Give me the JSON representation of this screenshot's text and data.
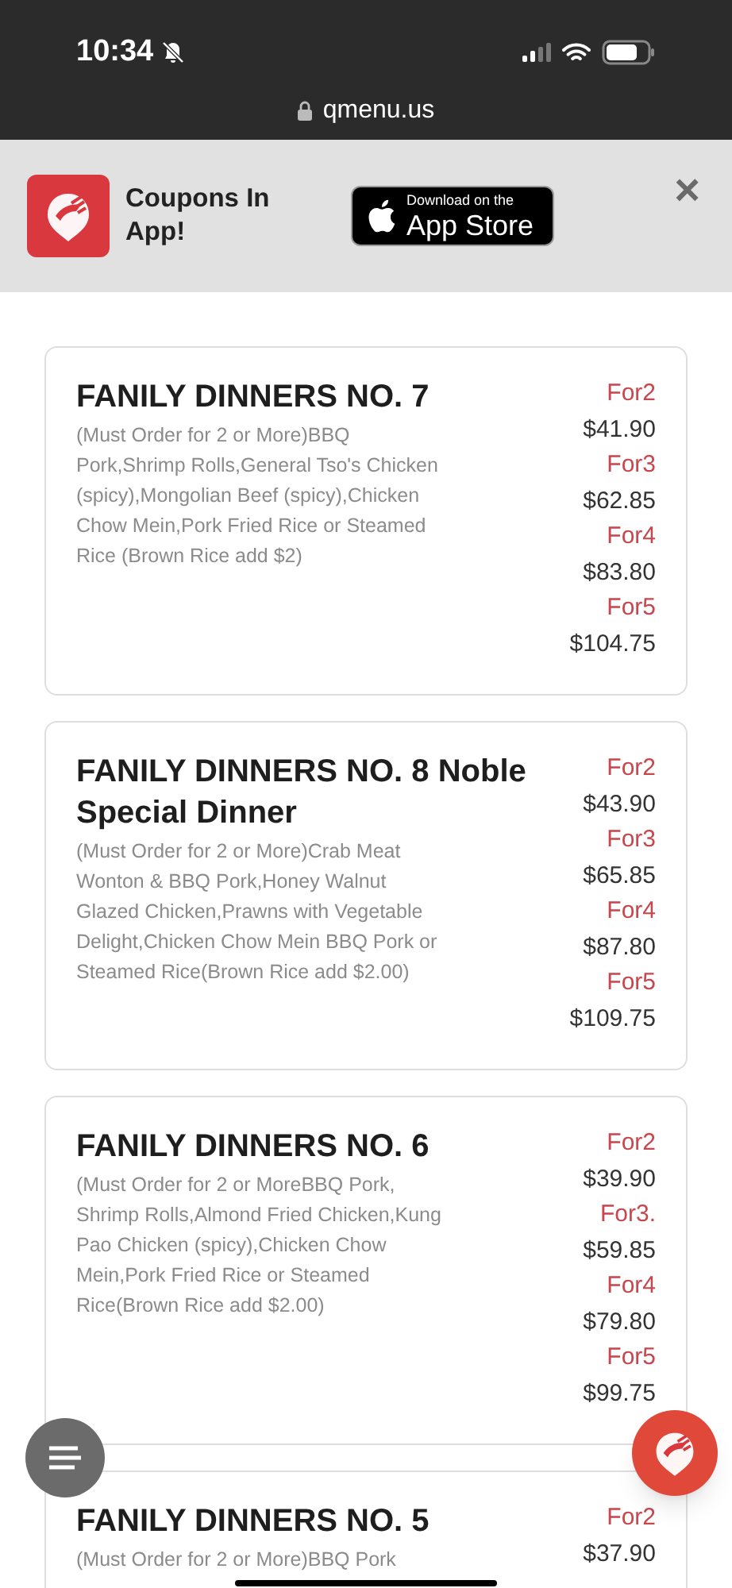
{
  "status_bar": {
    "time": "10:34"
  },
  "browser": {
    "url": "qmenu.us"
  },
  "banner": {
    "text": "Coupons In App!",
    "store_button": {
      "small": "Download on the",
      "large": "App Store"
    },
    "close": "×"
  },
  "dishes": [
    {
      "name": "FANILY DINNERS NO. 7",
      "description": "(Must Order for 2 or More)BBQ Pork,Shrimp Rolls,General Tso's Chicken (spicy),Mongolian Beef (spicy),Chicken Chow Mein,Pork Fried Rice or Steamed Rice (Brown Rice add $2)",
      "prices": [
        {
          "label": "For2",
          "price": "$41.90"
        },
        {
          "label": "For3",
          "price": "$62.85"
        },
        {
          "label": "For4",
          "price": "$83.80"
        },
        {
          "label": "For5",
          "price": "$104.75"
        }
      ]
    },
    {
      "name": "FANILY DINNERS NO. 8 Noble Special Dinner",
      "description": "(Must Order for 2 or More)Crab Meat Wonton & BBQ Pork,Honey Walnut Glazed Chicken,Prawns with Vegetable Delight,Chicken Chow Mein BBQ Pork or Steamed Rice(Brown Rice add $2.00)",
      "prices": [
        {
          "label": "For2",
          "price": "$43.90"
        },
        {
          "label": "For3",
          "price": "$65.85"
        },
        {
          "label": "For4",
          "price": "$87.80"
        },
        {
          "label": "For5",
          "price": "$109.75"
        }
      ]
    },
    {
      "name": "FANILY DINNERS NO. 6",
      "description": "(Must Order for 2 or MoreBBQ Pork, Shrimp Rolls,Almond Fried Chicken,Kung Pao Chicken (spicy),Chicken Chow Mein,Pork Fried Rice or Steamed Rice(Brown Rice add $2.00)",
      "prices": [
        {
          "label": "For2",
          "price": "$39.90"
        },
        {
          "label": "For3.",
          "price": "$59.85"
        },
        {
          "label": "For4",
          "price": "$79.80"
        },
        {
          "label": "For5",
          "price": "$99.75"
        }
      ]
    },
    {
      "name": "FANILY DINNERS NO. 5",
      "description": "(Must Order for 2 or More)BBQ Pork",
      "prices": [
        {
          "label": "For2",
          "price": "$37.90"
        }
      ]
    }
  ]
}
